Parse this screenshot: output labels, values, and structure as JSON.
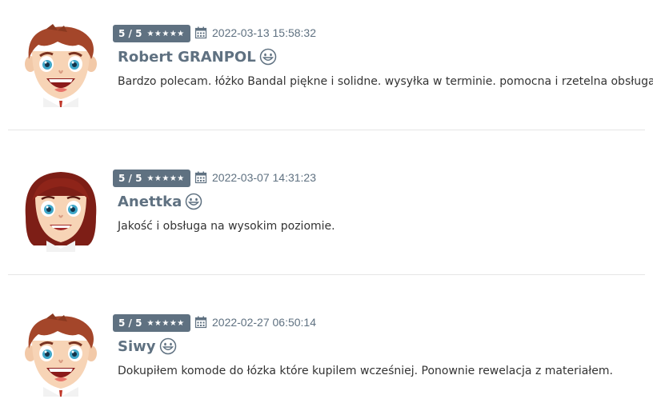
{
  "reviews": [
    {
      "rating": "5 / 5",
      "stars": "★★★★★",
      "date": "2022-03-13 15:58:32",
      "author": "Robert GRANPOL",
      "text": "Bardzo polecam. łóżko Bandal piękne i solidne. wysyłka w terminie. pomocna i rzetelna obsługa .",
      "avatar": "boy-avatar-icon"
    },
    {
      "rating": "5 / 5",
      "stars": "★★★★★",
      "date": "2022-03-07 14:31:23",
      "author": "Anettka",
      "text": "Jakość i obsługa na wysokim poziomie.",
      "avatar": "girl-avatar-icon"
    },
    {
      "rating": "5 / 5",
      "stars": "★★★★★",
      "date": "2022-02-27 06:50:14",
      "author": "Siwy",
      "text": "Dokupiłem komode do łózka które kupilem wcześniej. Ponownie rewelacja z materiałem.",
      "avatar": "boy-avatar-icon"
    }
  ],
  "colors": {
    "badge_bg": "#5f7181",
    "name": "#5f7181",
    "text": "#333333",
    "divider": "#e6e6e6"
  }
}
